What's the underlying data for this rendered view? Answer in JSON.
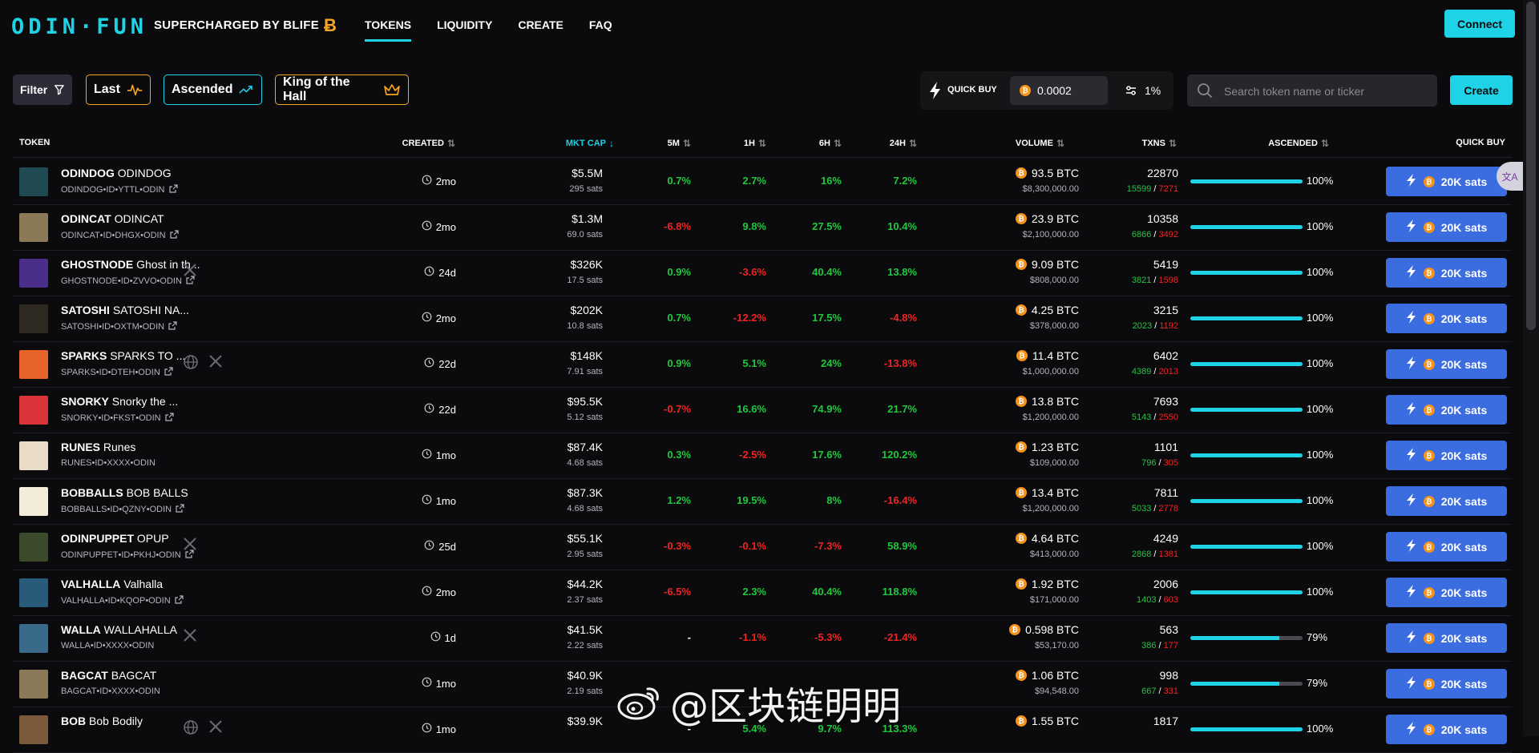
{
  "nav": {
    "logo": "ODIN·FUN",
    "tagline": "SUPERCHARGED BY BLIFE",
    "links": [
      "TOKENS",
      "LIQUIDITY",
      "CREATE",
      "FAQ"
    ],
    "connect_label": "Connect"
  },
  "filters": {
    "filter_label": "Filter",
    "last_label": "Last",
    "ascended_label": "Ascended",
    "king_label": "King of the Hall"
  },
  "quick_buy": {
    "label": "QUICK BUY",
    "amount": "0.0002",
    "slippage": "1%"
  },
  "search": {
    "placeholder": "Search token name or ticker"
  },
  "create_label": "Create",
  "columns": {
    "token": "TOKEN",
    "created": "CREATED",
    "mkt_cap": "MKT CAP",
    "m5": "5M",
    "h1": "1H",
    "h6": "6H",
    "h24": "24H",
    "volume": "VOLUME",
    "txns": "TXNS",
    "ascended": "ASCENDED",
    "quick_buy": "QUICK BUY"
  },
  "buy_label": "20K sats",
  "colors": {
    "accent": "#1fd3e6",
    "positive": "#21c73d",
    "negative": "#ef2424",
    "buy_button": "#3b6ce0",
    "btc": "#f6931a"
  },
  "rows": [
    {
      "ticker": "ODINDOG",
      "name": "ODINDOG",
      "id": "ODINDOG•ID•YTTL•ODIN",
      "link": true,
      "socials": [],
      "created": "2mo",
      "mcap": "$5.5M",
      "sats": "295 sats",
      "m5": "0.7%",
      "h1": "2.7%",
      "h6": "16%",
      "h24": "7.2%",
      "volume": "93.5 BTC",
      "volume_usd": "$8,300,000.00",
      "txns": "22870",
      "buys": "15599",
      "sells": "7271",
      "ascended": 100,
      "ascended_label": "100%",
      "avatar_color": "#1f4a52"
    },
    {
      "ticker": "ODINCAT",
      "name": "ODINCAT",
      "id": "ODINCAT•ID•DHGX•ODIN",
      "link": true,
      "socials": [],
      "created": "2mo",
      "mcap": "$1.3M",
      "sats": "69.0 sats",
      "m5": "-6.8%",
      "h1": "9.8%",
      "h6": "27.5%",
      "h24": "10.4%",
      "volume": "23.9 BTC",
      "volume_usd": "$2,100,000.00",
      "txns": "10358",
      "buys": "6866",
      "sells": "3492",
      "ascended": 100,
      "ascended_label": "100%",
      "avatar_color": "#8a7a55"
    },
    {
      "ticker": "GHOSTNODE",
      "name": "Ghost in th...",
      "id": "GHOSTNODE•ID•ZVVO•ODIN",
      "link": true,
      "socials": [
        "x"
      ],
      "created": "24d",
      "mcap": "$326K",
      "sats": "17.5 sats",
      "m5": "0.9%",
      "h1": "-3.6%",
      "h6": "40.4%",
      "h24": "13.8%",
      "volume": "9.09 BTC",
      "volume_usd": "$808,000.00",
      "txns": "5419",
      "buys": "3821",
      "sells": "1598",
      "ascended": 100,
      "ascended_label": "100%",
      "avatar_color": "#4b2d8a"
    },
    {
      "ticker": "SATOSHI",
      "name": "SATOSHI NA...",
      "id": "SATOSHI•ID•OXTM•ODIN",
      "link": true,
      "socials": [],
      "created": "2mo",
      "mcap": "$202K",
      "sats": "10.8 sats",
      "m5": "0.7%",
      "h1": "-12.2%",
      "h6": "17.5%",
      "h24": "-4.8%",
      "volume": "4.25 BTC",
      "volume_usd": "$378,000.00",
      "txns": "3215",
      "buys": "2023",
      "sells": "1192",
      "ascended": 100,
      "ascended_label": "100%",
      "avatar_color": "#2e2a22"
    },
    {
      "ticker": "SPARKS",
      "name": "SPARKS TO ...",
      "id": "SPARKS•ID•DTEH•ODIN",
      "link": true,
      "socials": [
        "web",
        "x"
      ],
      "created": "22d",
      "mcap": "$148K",
      "sats": "7.91 sats",
      "m5": "0.9%",
      "h1": "5.1%",
      "h6": "24%",
      "h24": "-13.8%",
      "volume": "11.4 BTC",
      "volume_usd": "$1,000,000.00",
      "txns": "6402",
      "buys": "4389",
      "sells": "2013",
      "ascended": 100,
      "ascended_label": "100%",
      "avatar_color": "#e8632a"
    },
    {
      "ticker": "SNORKY",
      "name": "Snorky the ...",
      "id": "SNORKY•ID•FKST•ODIN",
      "link": true,
      "socials": [],
      "created": "22d",
      "mcap": "$95.5K",
      "sats": "5.12 sats",
      "m5": "-0.7%",
      "h1": "16.6%",
      "h6": "74.9%",
      "h24": "21.7%",
      "volume": "13.8 BTC",
      "volume_usd": "$1,200,000.00",
      "txns": "7693",
      "buys": "5143",
      "sells": "2550",
      "ascended": 100,
      "ascended_label": "100%",
      "avatar_color": "#d8343a"
    },
    {
      "ticker": "RUNES",
      "name": "Runes",
      "id": "RUNES•ID•XXXX•ODIN",
      "link": false,
      "socials": [],
      "created": "1mo",
      "mcap": "$87.4K",
      "sats": "4.68 sats",
      "m5": "0.3%",
      "h1": "-2.5%",
      "h6": "17.6%",
      "h24": "120.2%",
      "volume": "1.23 BTC",
      "volume_usd": "$109,000.00",
      "txns": "1101",
      "buys": "796",
      "sells": "305",
      "ascended": 100,
      "ascended_label": "100%",
      "avatar_color": "#e8dcc8"
    },
    {
      "ticker": "BOBBALLS",
      "name": "BOB BALLS",
      "id": "BOBBALLS•ID•QZNY•ODIN",
      "link": true,
      "socials": [],
      "created": "1mo",
      "mcap": "$87.3K",
      "sats": "4.68 sats",
      "m5": "1.2%",
      "h1": "19.5%",
      "h6": "8%",
      "h24": "-16.4%",
      "volume": "13.4 BTC",
      "volume_usd": "$1,200,000.00",
      "txns": "7811",
      "buys": "5033",
      "sells": "2778",
      "ascended": 100,
      "ascended_label": "100%",
      "avatar_color": "#f2ecd8"
    },
    {
      "ticker": "ODINPUPPET",
      "name": "OPUP",
      "id": "ODINPUPPET•ID•PKHJ•ODIN",
      "link": true,
      "socials": [
        "x"
      ],
      "created": "25d",
      "mcap": "$55.1K",
      "sats": "2.95 sats",
      "m5": "-0.3%",
      "h1": "-0.1%",
      "h6": "-7.3%",
      "h24": "58.9%",
      "volume": "4.64 BTC",
      "volume_usd": "$413,000.00",
      "txns": "4249",
      "buys": "2868",
      "sells": "1381",
      "ascended": 100,
      "ascended_label": "100%",
      "avatar_color": "#3a4a2a"
    },
    {
      "ticker": "VALHALLA",
      "name": "Valhalla",
      "id": "VALHALLA•ID•KQOP•ODIN",
      "link": true,
      "socials": [],
      "created": "2mo",
      "mcap": "$44.2K",
      "sats": "2.37 sats",
      "m5": "-6.5%",
      "h1": "2.3%",
      "h6": "40.4%",
      "h24": "118.8%",
      "volume": "1.92 BTC",
      "volume_usd": "$171,000.00",
      "txns": "2006",
      "buys": "1403",
      "sells": "603",
      "ascended": 100,
      "ascended_label": "100%",
      "avatar_color": "#2a5a7a"
    },
    {
      "ticker": "WALLA",
      "name": "WALLAHALLA",
      "id": "WALLA•ID•XXXX•ODIN",
      "link": false,
      "socials": [
        "x"
      ],
      "created": "1d",
      "mcap": "$41.5K",
      "sats": "2.22 sats",
      "m5": "-",
      "h1": "-1.1%",
      "h6": "-5.3%",
      "h24": "-21.4%",
      "volume": "0.598 BTC",
      "volume_usd": "$53,170.00",
      "txns": "563",
      "buys": "386",
      "sells": "177",
      "ascended": 79,
      "ascended_label": "79%",
      "avatar_color": "#3a6a8a"
    },
    {
      "ticker": "BAGCAT",
      "name": "BAGCAT",
      "id": "BAGCAT•ID•XXXX•ODIN",
      "link": false,
      "socials": [],
      "created": "1mo",
      "mcap": "$40.9K",
      "sats": "2.19 sats",
      "m5": "",
      "h1": "",
      "h6": "",
      "h24": "",
      "volume": "1.06 BTC",
      "volume_usd": "$94,548.00",
      "txns": "998",
      "buys": "667",
      "sells": "331",
      "ascended": 79,
      "ascended_label": "79%",
      "avatar_color": "#8a7a5a"
    },
    {
      "ticker": "BOB",
      "name": "Bob Bodily",
      "id": "",
      "link": false,
      "socials": [
        "web",
        "x"
      ],
      "created": "1mo",
      "mcap": "$39.9K",
      "sats": "",
      "m5": "-",
      "h1": "5.4%",
      "h6": "9.7%",
      "h24": "113.3%",
      "volume": "1.55 BTC",
      "volume_usd": "",
      "txns": "1817",
      "buys": "",
      "sells": "",
      "ascended": 100,
      "ascended_label": "100%",
      "avatar_color": "#7a5a3a"
    }
  ],
  "watermark": "@区块链明明"
}
